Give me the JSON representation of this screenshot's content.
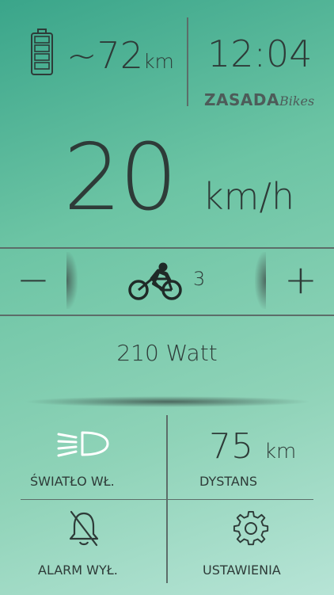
{
  "status": {
    "range_value": "~72",
    "range_unit": "km",
    "time": "12:04",
    "brand_bold": "ZASADA",
    "brand_script": "Bikes",
    "battery_level": 1.0
  },
  "speed": {
    "value": "20",
    "unit": "km/h"
  },
  "assist": {
    "decrease_label": "−",
    "increase_label": "+",
    "level": "3",
    "icon": "cyclist-icon"
  },
  "power": {
    "text": "210 Watt"
  },
  "tiles": {
    "light": {
      "label": "ŚWIATŁO WŁ.",
      "icon": "headlight-icon"
    },
    "distance": {
      "value": "75",
      "unit": "km",
      "label": "DYSTANS"
    },
    "alarm": {
      "label": "ALARM WYŁ.",
      "icon": "bell-off-icon"
    },
    "settings": {
      "label": "USTAWIENIA",
      "icon": "gear-icon"
    }
  },
  "colors": {
    "text": "#2e3b38",
    "lines": "#5c6d69",
    "bg_start": "#3aa58a",
    "bg_end": "#b7e4d6"
  }
}
